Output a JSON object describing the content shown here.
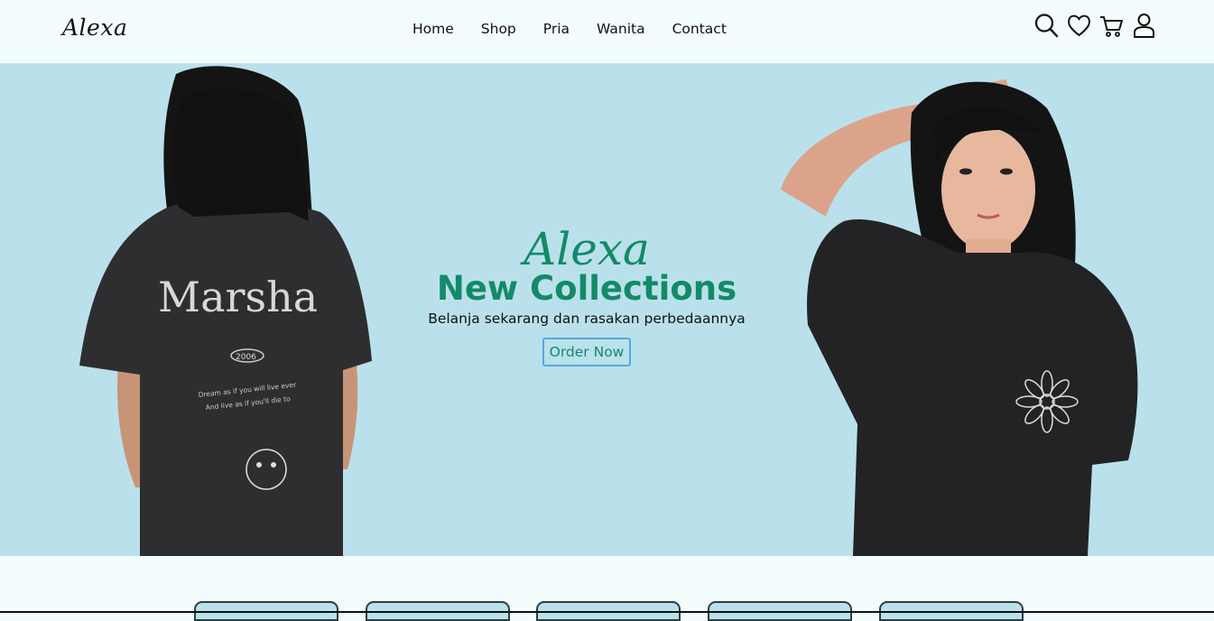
{
  "header": {
    "logo": "Alexa",
    "nav": [
      "Home",
      "Shop",
      "Pria",
      "Wanita",
      "Contact"
    ],
    "icons": [
      "search-icon",
      "heart-icon",
      "cart-icon",
      "user-icon"
    ]
  },
  "hero": {
    "brand": "Alexa",
    "headline": "New Collections",
    "tagline": "Belanja sekarang dan rasakan perbedaannya",
    "cta_label": "Order Now",
    "left_shirt_print": "Marsha",
    "left_shirt_year": "2006",
    "left_shirt_lines": [
      "Dream as if you will live ever",
      "And live as if you'll die to"
    ]
  },
  "colors": {
    "background": "#f4fdfd",
    "hero_bg": "#bae1eb",
    "accent": "#138a68",
    "button_border": "#52a9e3"
  }
}
